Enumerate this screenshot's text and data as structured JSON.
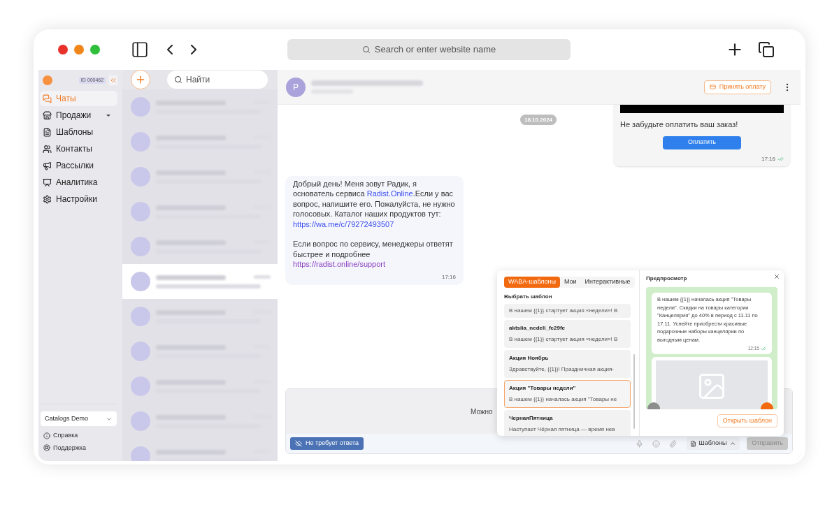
{
  "browser": {
    "address_placeholder": "Search or enter website name"
  },
  "sidebar": {
    "account_id": "ID 000462",
    "nav": [
      {
        "label": "Чаты",
        "selected": true,
        "has_submenu": false
      },
      {
        "label": "Продажи",
        "selected": false,
        "has_submenu": true
      },
      {
        "label": "Шаблоны",
        "selected": false,
        "has_submenu": false
      },
      {
        "label": "Контакты",
        "selected": false,
        "has_submenu": false
      },
      {
        "label": "Рассылки",
        "selected": false,
        "has_submenu": false
      },
      {
        "label": "Аналитика",
        "selected": false,
        "has_submenu": false
      },
      {
        "label": "Настройки",
        "selected": false,
        "has_submenu": false
      }
    ],
    "workspace": "Catalogs Demo",
    "footer_links": [
      {
        "label": "Справка"
      },
      {
        "label": "Поддержка"
      }
    ]
  },
  "chat_list": {
    "search_placeholder": "Найти",
    "items": [
      {
        "selected": false
      },
      {
        "selected": false
      },
      {
        "selected": false
      },
      {
        "selected": false
      },
      {
        "selected": false
      },
      {
        "selected": true
      },
      {
        "selected": false
      },
      {
        "selected": false
      },
      {
        "selected": false
      },
      {
        "selected": false
      },
      {
        "selected": false
      }
    ]
  },
  "chat": {
    "avatar_letter": "P",
    "action_button": "Принять оплату",
    "date": "18.10.2024",
    "outgoing": {
      "text": "Не забудьте оплатить ваш заказ!",
      "button": "Оплатить",
      "time": "17:16",
      "read": true
    },
    "incoming": {
      "paragraphs": [
        [
          {
            "kind": "text",
            "text": "Добрый день! Меня зовут Радик, я основатель сервиса "
          },
          {
            "kind": "link",
            "text": "Radist.Online"
          },
          {
            "kind": "text",
            "text": ".Если у вас вопрос, напишите его. Пожалуйста, не нужно голосовых. Каталог наших продуктов тут: "
          },
          {
            "kind": "link",
            "text": "https://wa.me/c/79272493507"
          }
        ],
        [
          {
            "kind": "text",
            "text": "Если вопрос по сервису, менеджеры ответят быстрее и подробнее "
          },
          {
            "kind": "visited_link",
            "text": "https://radist.online/support"
          }
        ]
      ],
      "time": "17:16"
    }
  },
  "composer": {
    "hint": "Можно",
    "no_reply_button": "Не требует ответа",
    "templates_button": "Шаблоны",
    "send_button": "Отправить"
  },
  "template_popup": {
    "tabs": [
      {
        "label": "WABA-шаблоны",
        "selected": true
      },
      {
        "label": "Мои",
        "selected": false
      },
      {
        "label": "Интерактивные",
        "selected": false
      }
    ],
    "section_title": "Выбрать шаблон",
    "templates": [
      {
        "preview": "В нашем {{1}} стартует акция «недели»! В",
        "selected": false
      },
      {
        "name": "aktsiia_nedeli_fc29fe",
        "preview": "В нашем {{1}} стартует акция «недели»! В",
        "selected": false
      },
      {
        "name": "Акция Ноябрь",
        "preview": "Здравствуйте, {{1}}! Праздничная акция-",
        "selected": false
      },
      {
        "name": "Акция \"Товары недели\"",
        "preview": "В нашем {{1}} началась акция \"Товары не",
        "selected": true
      },
      {
        "name": "ЧернаяПятница",
        "preview": "Наступает Чёрная пятница — время нев",
        "selected": false
      }
    ],
    "preview_title": "Предпросмотр",
    "preview_text": "В нашем {{1}} началась акция \"Товары недели\". Скидки на товары категории \"Канцелярия\" до 40% в период с 11.11 по 17.11. Успейте приобрести красивые подарочные наборы канцелярии по выгодным ценам.",
    "preview_time": "12:15",
    "preview_read": true,
    "open_button": "Открыть шаблон"
  }
}
